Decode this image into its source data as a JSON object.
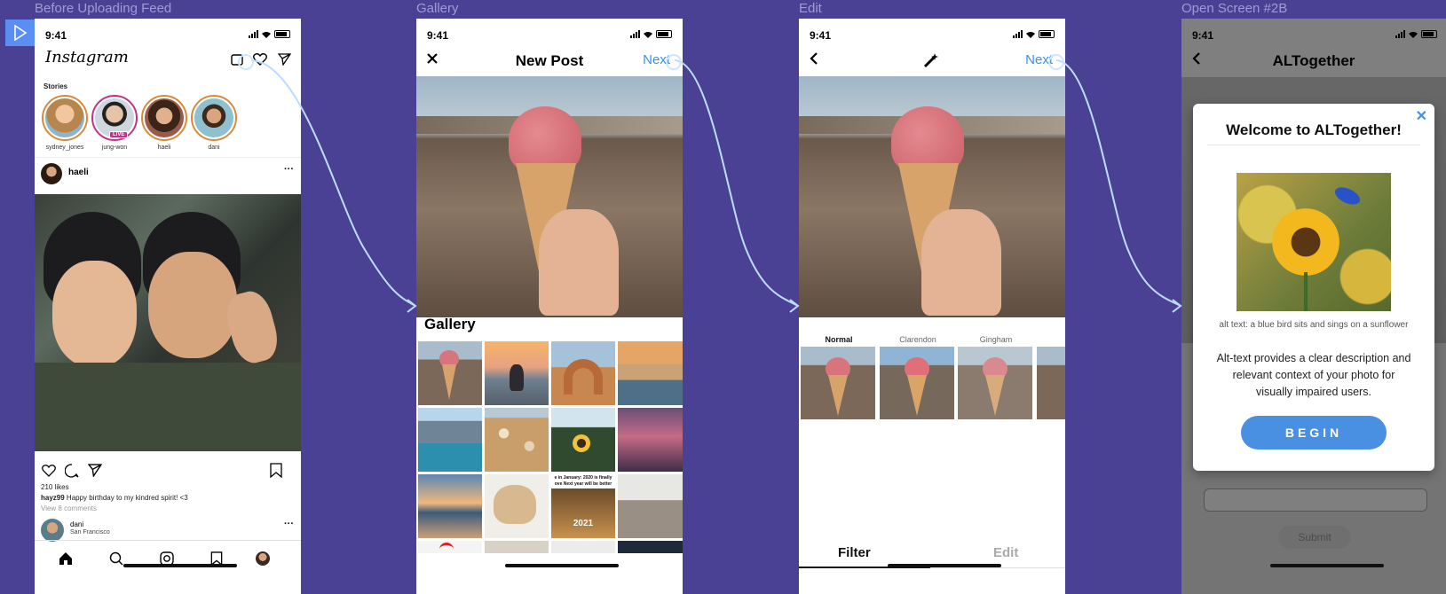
{
  "frames": {
    "f1": "Before Uploading Feed",
    "f2": "Gallery",
    "f3": "Edit",
    "f4": "Open Screen #2B"
  },
  "status_time": "9:41",
  "feed": {
    "logo": "Instagram",
    "stories_label": "Stories",
    "stories": [
      "sydney_jones",
      "jung-won",
      "haeli",
      "dani"
    ],
    "live_badge": "LIVE",
    "post_user": "haeli",
    "more": "···",
    "likes": "210 likes",
    "caption_user": "hayz99",
    "caption_text": "Happy birthday to my kindred spirit! <3",
    "view_comments": "View 8 comments",
    "next_user": "dani",
    "next_location": "San Francisco"
  },
  "gallery": {
    "title": "New Post",
    "next": "Next",
    "section": "Gallery",
    "meme_caption": "e in January: 2020 is finally ove Next year will be better",
    "meme_year": "2021"
  },
  "edit": {
    "next": "Next",
    "filters": [
      "Normal",
      "Clarendon",
      "Gingham"
    ],
    "tab_filter": "Filter",
    "tab_edit": "Edit"
  },
  "alt": {
    "title": "ALTogether",
    "modal_title": "Welcome to ALTogether!",
    "alt_text": "alt text: a blue bird sits and sings on a sunflower",
    "desc": "Alt-text provides a clear description and relevant context of your photo for visually impaired users.",
    "begin": "BEGIN",
    "submit": "Submit",
    "close": "✕"
  },
  "icons": {
    "play": "play-icon",
    "heart": "heart-icon",
    "send": "send-icon",
    "close": "close-icon",
    "back": "chevron-left-icon",
    "wand": "magic-wand-icon"
  },
  "colors": {
    "canvas": "#4a4194",
    "accent": "#3b8ff0",
    "begin_button": "#4a90e2",
    "story_ring": "#c13584"
  }
}
